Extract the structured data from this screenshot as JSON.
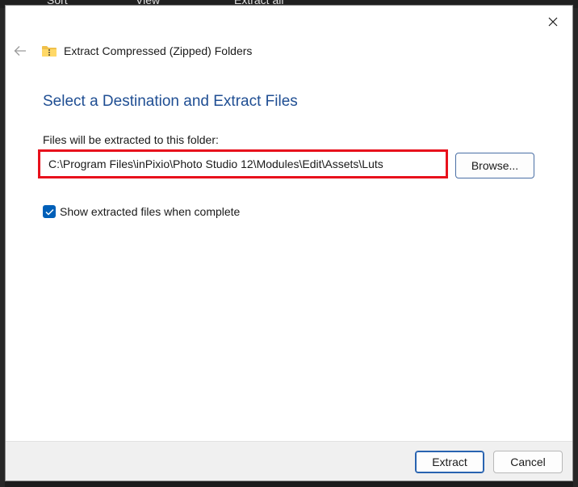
{
  "background_toolbar": {
    "items": [
      "Sort",
      "View",
      "Extract all"
    ]
  },
  "dialog": {
    "title": "Extract Compressed (Zipped) Folders",
    "heading": "Select a Destination and Extract Files",
    "destination_label": "Files will be extracted to this folder:",
    "destination_path": "C:\\Program Files\\inPixio\\Photo Studio 12\\Modules\\Edit\\Assets\\Luts",
    "browse_label": "Browse...",
    "show_files_label": "Show extracted files when complete",
    "show_files_checked": true,
    "extract_label": "Extract",
    "cancel_label": "Cancel"
  },
  "colors": {
    "heading": "#1f4e93",
    "highlight_border": "#e8111c",
    "checkbox": "#005fb8"
  }
}
